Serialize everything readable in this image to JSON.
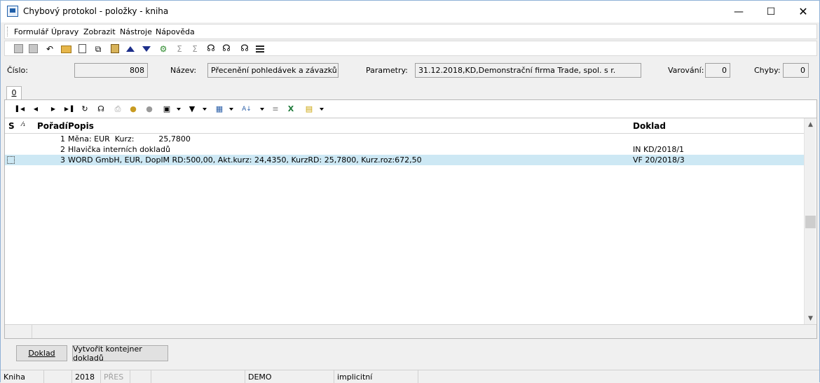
{
  "window": {
    "title": "Chybový protokol - položky - kniha"
  },
  "menu": [
    "Formulář",
    "Úpravy",
    "Zobrazit",
    "Nástroje",
    "Nápověda"
  ],
  "header": {
    "cislo_label": "Číslo:",
    "cislo_value": "808",
    "nazev_label": "Název:",
    "nazev_value": "Přecenění pohledávek a závazků",
    "parametry_label": "Parametry:",
    "parametry_value": "31.12.2018,KD,Demonstrační firma Trade, spol. s r.",
    "varovani_label": "Varování:",
    "varovani_value": "0",
    "chyby_label": "Chyby:",
    "chyby_value": "0"
  },
  "tab": {
    "label": "0"
  },
  "grid": {
    "columns": {
      "s": "S",
      "sort": "⁄₁",
      "poradi": "Pořadí",
      "popis": "Popis",
      "doklad": "Doklad"
    },
    "rows": [
      {
        "poradi": "1",
        "popis": "Měna: EUR  Kurz:          25,7800",
        "doklad": ""
      },
      {
        "poradi": "2",
        "popis": "Hlavička interních dokladů",
        "doklad": "IN KD/2018/1"
      },
      {
        "poradi": "3",
        "popis": "WORD GmbH, EUR, DoplM RD:500,00, Akt.kurz: 24,4350, KurzRD: 25,7800, Kurz.roz:672,50",
        "doklad": "VF 20/2018/3"
      }
    ]
  },
  "buttons": {
    "doklad": "Doklad",
    "kontejner": "Vytvořit kontejner dokladů"
  },
  "statusbar": {
    "kniha": "Kniha",
    "year": "2018",
    "mode": "PŘES",
    "firm": "DEMO",
    "profile": "implicitní"
  },
  "icons": {
    "toolbar1": [
      "save-icon",
      "save-as-icon",
      "undo-icon",
      "open-folder-icon",
      "new-document-icon",
      "copy-icon",
      "book-icon",
      "arrow-up-icon",
      "arrow-down-icon",
      "green-tool-icon",
      "sum-icon",
      "sum-grey-icon",
      "binoculars-icon",
      "binoculars-next-icon",
      "binoculars-find-icon",
      "lines-icon"
    ],
    "toolbar2": [
      "first-record-icon",
      "prev-record-icon",
      "next-record-icon",
      "last-record-icon",
      "refresh-icon",
      "binoculars-icon",
      "print-icon",
      "lock-icon",
      "lock-grey-icon",
      "camera-icon",
      "filter-icon",
      "table-edit-icon",
      "sort-az-icon",
      "list-icon",
      "excel-icon",
      "notes-icon"
    ]
  }
}
